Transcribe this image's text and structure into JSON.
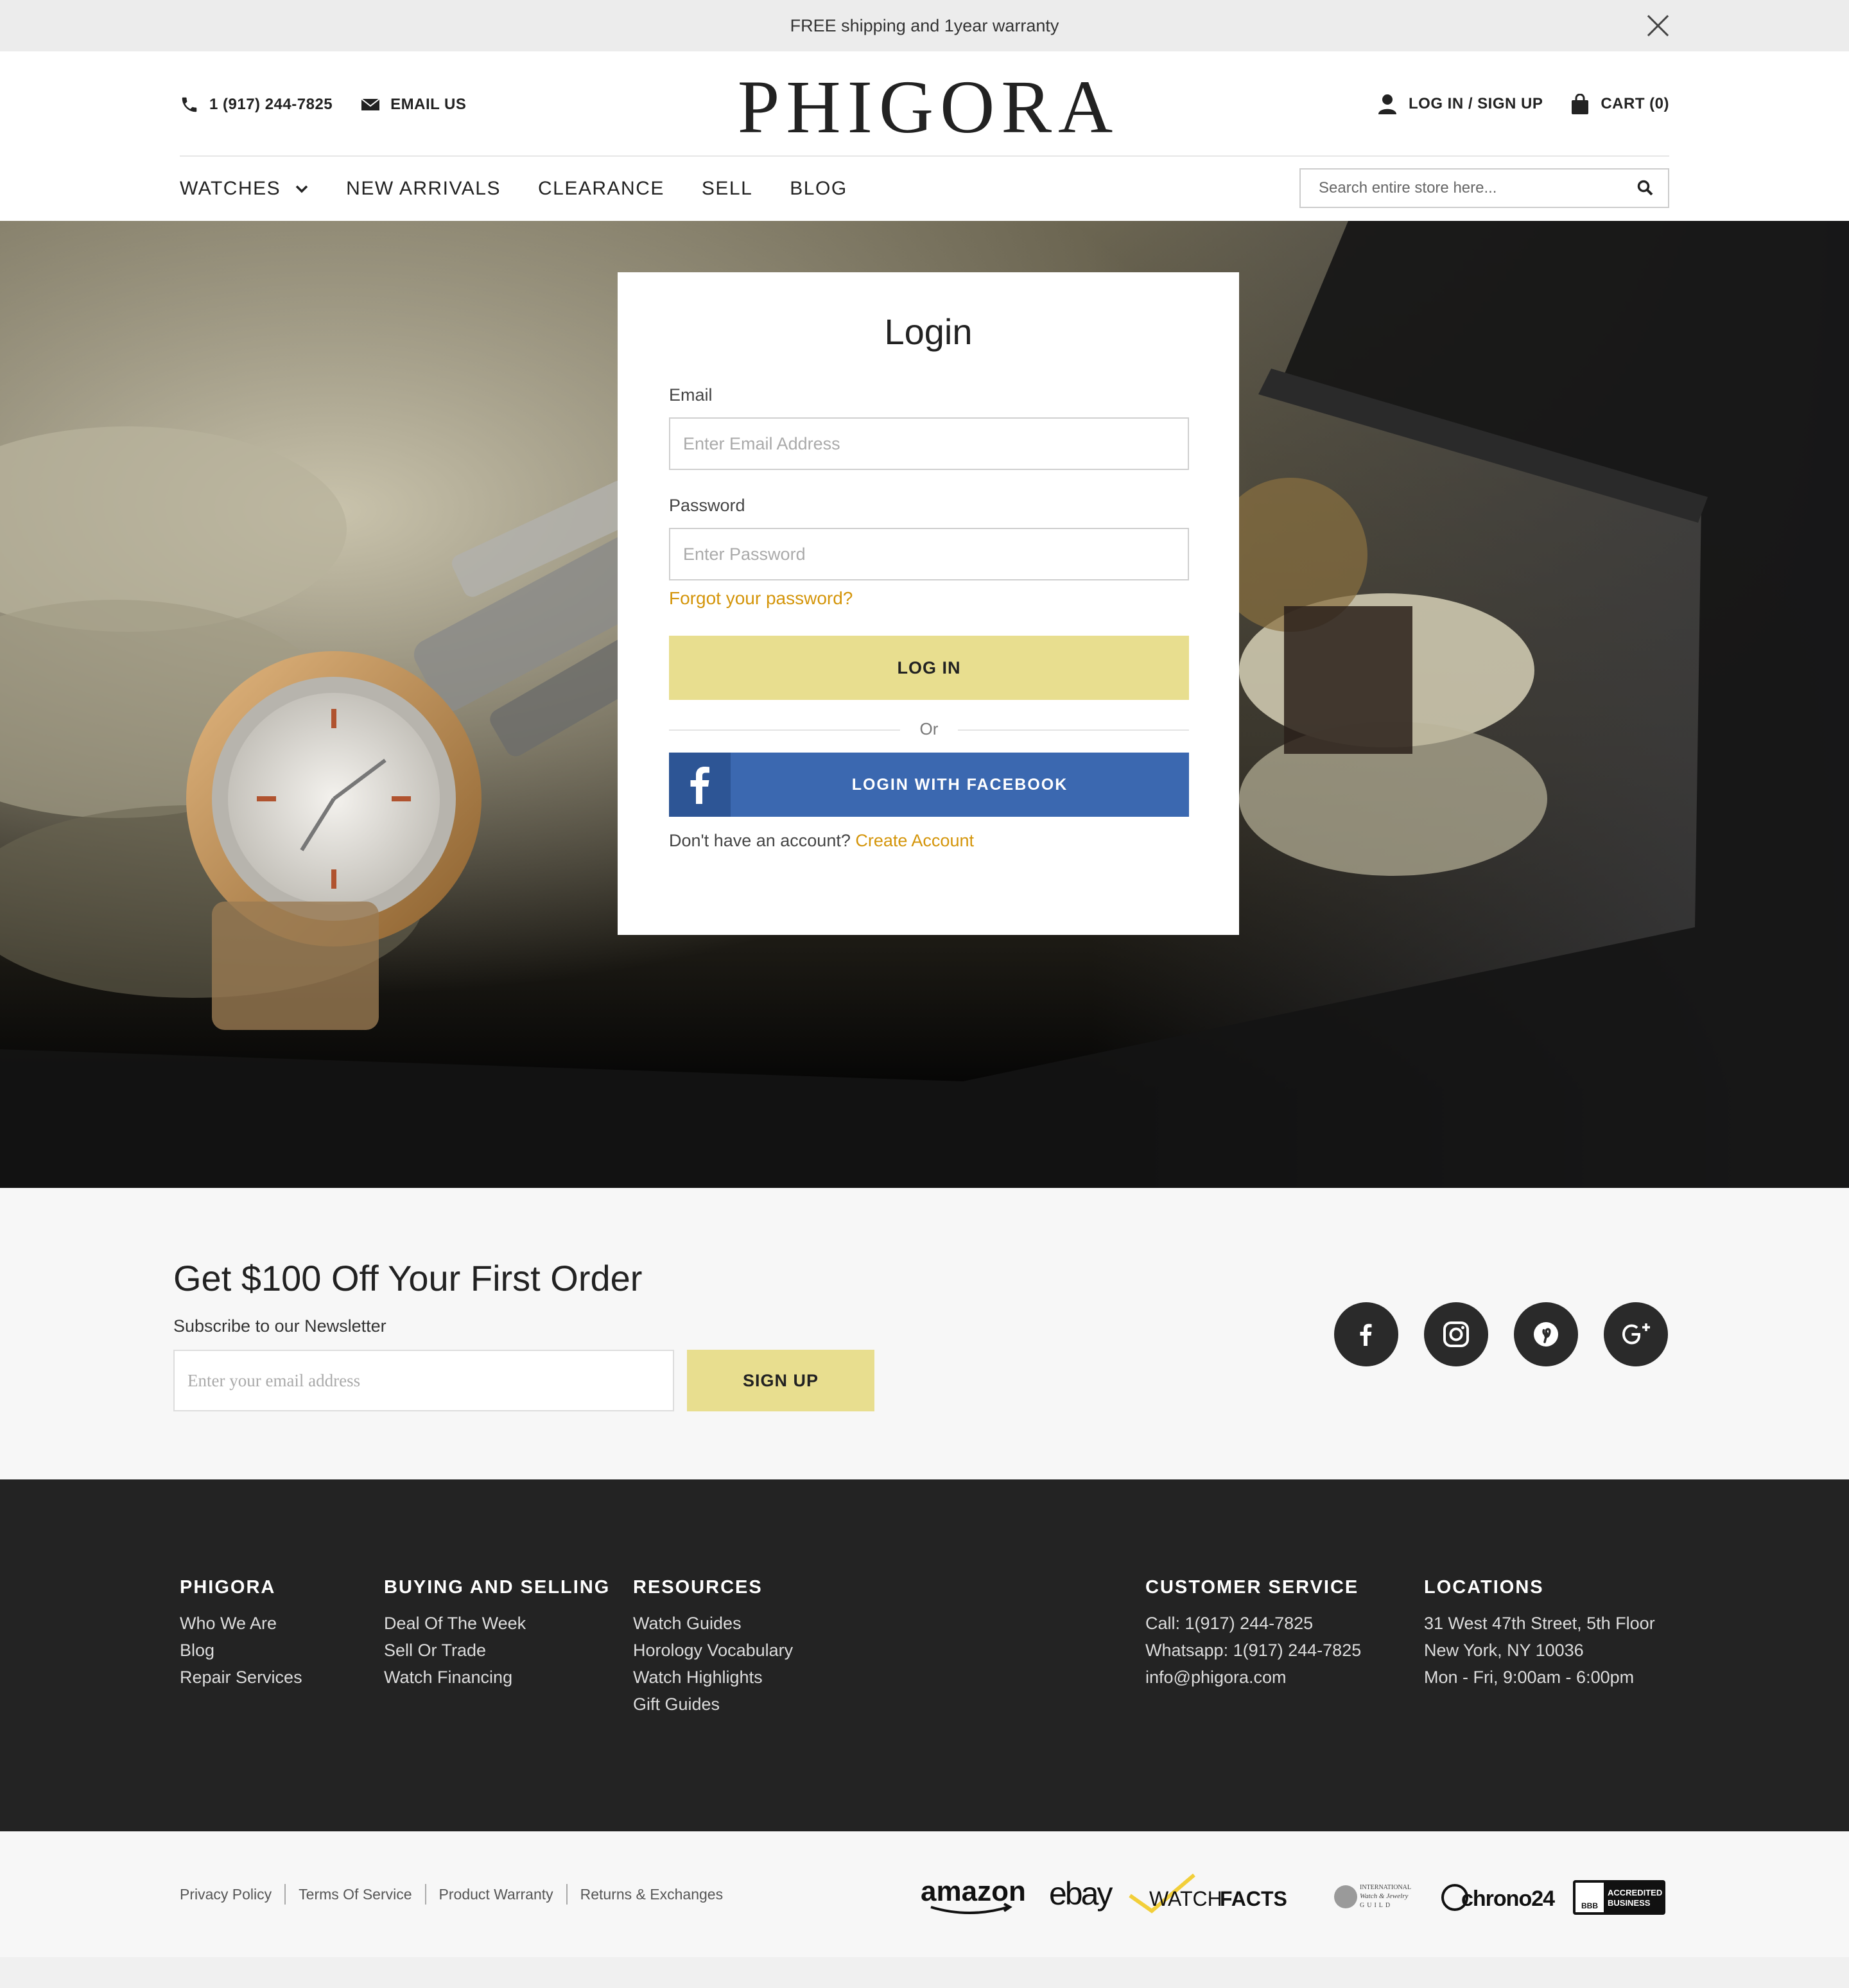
{
  "announcement": {
    "text": "FREE shipping and  1year warranty"
  },
  "header": {
    "phone": "1 (917) 244-7825",
    "email_label": "EMAIL US",
    "logo_text": "PHIGORA",
    "login_label": "LOG IN / SIGN UP",
    "cart_label": "CART (0)"
  },
  "nav": {
    "items": [
      "WATCHES",
      "NEW ARRIVALS",
      "CLEARANCE",
      "SELL",
      "BLOG"
    ],
    "search_placeholder": "Search entire store here..."
  },
  "login": {
    "title": "Login",
    "email_label": "Email",
    "email_placeholder": "Enter Email Address",
    "password_label": "Password",
    "password_placeholder": "Enter Password",
    "forgot": "Forgot your password?",
    "login_button": "LOG IN",
    "or": "Or",
    "facebook_button": "LOGIN WITH FACEBOOK",
    "no_account": "Don't have an account?",
    "create_account": "Create Account"
  },
  "newsletter": {
    "title": "Get $100 Off Your First Order",
    "subtitle": "Subscribe to our Newsletter",
    "placeholder": "Enter your email address",
    "button": "SIGN UP",
    "socials": [
      "facebook-icon",
      "instagram-icon",
      "pinterest-icon",
      "google-plus-icon"
    ]
  },
  "footer": {
    "columns": [
      {
        "title": "PHIGORA",
        "links": [
          "Who We Are",
          "Blog",
          "Repair Services"
        ]
      },
      {
        "title": "BUYING AND SELLING",
        "links": [
          "Deal Of The Week",
          "Sell Or Trade",
          "Watch Financing"
        ]
      },
      {
        "title": "RESOURCES",
        "links": [
          "Watch Guides",
          "Horology Vocabulary",
          "Watch Highlights",
          "Gift Guides"
        ]
      },
      {
        "title": "CUSTOMER SERVICE",
        "links": [
          "Call: 1(917) 244-7825",
          "Whatsapp: 1(917) 244-7825",
          "info@phigora.com"
        ]
      },
      {
        "title": "LOCATIONS",
        "links": [
          "31 West 47th Street, 5th Floor",
          "New York, NY 10036",
          "Mon - Fri, 9:00am - 6:00pm"
        ]
      }
    ]
  },
  "bottom": {
    "legal": [
      "Privacy Policy",
      "Terms Of Service",
      "Product Warranty",
      "Returns & Exchanges"
    ],
    "partners": {
      "amazon": "amazon",
      "ebay": "ebay",
      "watchfacts_a": "WATCH",
      "watchfacts_b": "FACTS",
      "iwjg_1": "INTERNATIONAL",
      "iwjg_2": "Watch & Jewelry",
      "iwjg_3": "GUILD",
      "chrono24": "chrono24",
      "bbb_1": "ACCREDITED",
      "bbb_2": "BUSINESS",
      "bbb_3": "BBB"
    }
  },
  "colors": {
    "accent_yellow": "#e8de8f",
    "link_gold": "#d4950a",
    "facebook_blue": "#3b68b0",
    "footer_dark": "#232323"
  }
}
